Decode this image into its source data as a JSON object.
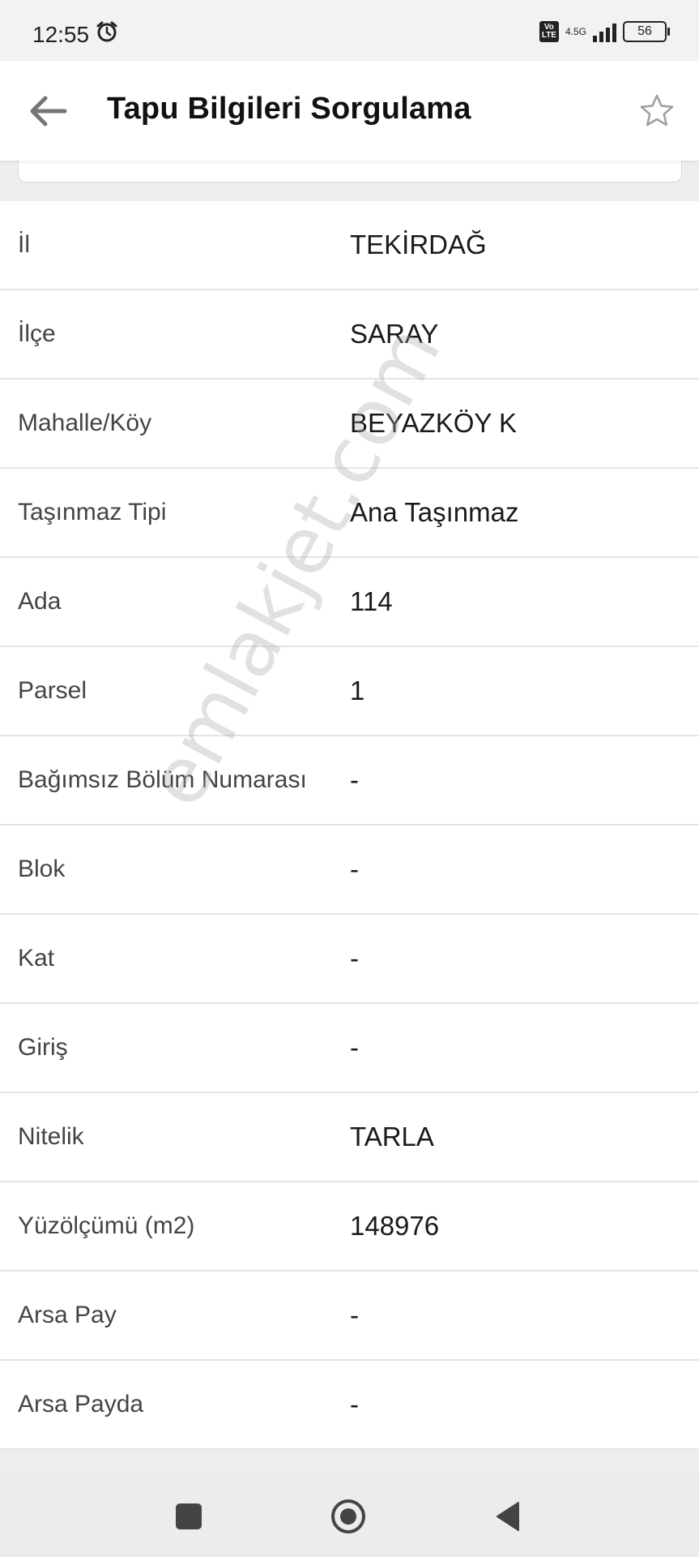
{
  "status_bar": {
    "time": "12:55",
    "volte": "Vo\nLTE",
    "network": "4.5G",
    "battery": "56"
  },
  "app_bar": {
    "title": "Tapu Bilgileri Sorgulama"
  },
  "watermark": "emlakjet.com",
  "rows": [
    {
      "label": "İl",
      "value": "TEKİRDAĞ"
    },
    {
      "label": "İlçe",
      "value": "SARAY"
    },
    {
      "label": "Mahalle/Köy",
      "value": "BEYAZKÖY K"
    },
    {
      "label": "Taşınmaz Tipi",
      "value": "Ana Taşınmaz"
    },
    {
      "label": "Ada",
      "value": "114"
    },
    {
      "label": "Parsel",
      "value": "1"
    },
    {
      "label": "Bağımsız Bölüm Numarası",
      "value": "-"
    },
    {
      "label": "Blok",
      "value": "-"
    },
    {
      "label": "Kat",
      "value": "-"
    },
    {
      "label": "Giriş",
      "value": "-"
    },
    {
      "label": "Nitelik",
      "value": "TARLA"
    },
    {
      "label": "Yüzölçümü (m2)",
      "value": "148976"
    },
    {
      "label": "Arsa Pay",
      "value": "-"
    },
    {
      "label": "Arsa Payda",
      "value": "-"
    }
  ],
  "icons": {
    "back": "arrow-left-icon",
    "favorite": "star-outline-icon",
    "alarm": "alarm-clock-icon",
    "nav_recents": "square-icon",
    "nav_home": "circle-icon",
    "nav_back": "triangle-left-icon"
  },
  "colors": {
    "accent_grey": "#757575",
    "background": "#eeeeee",
    "surface": "#ffffff"
  }
}
